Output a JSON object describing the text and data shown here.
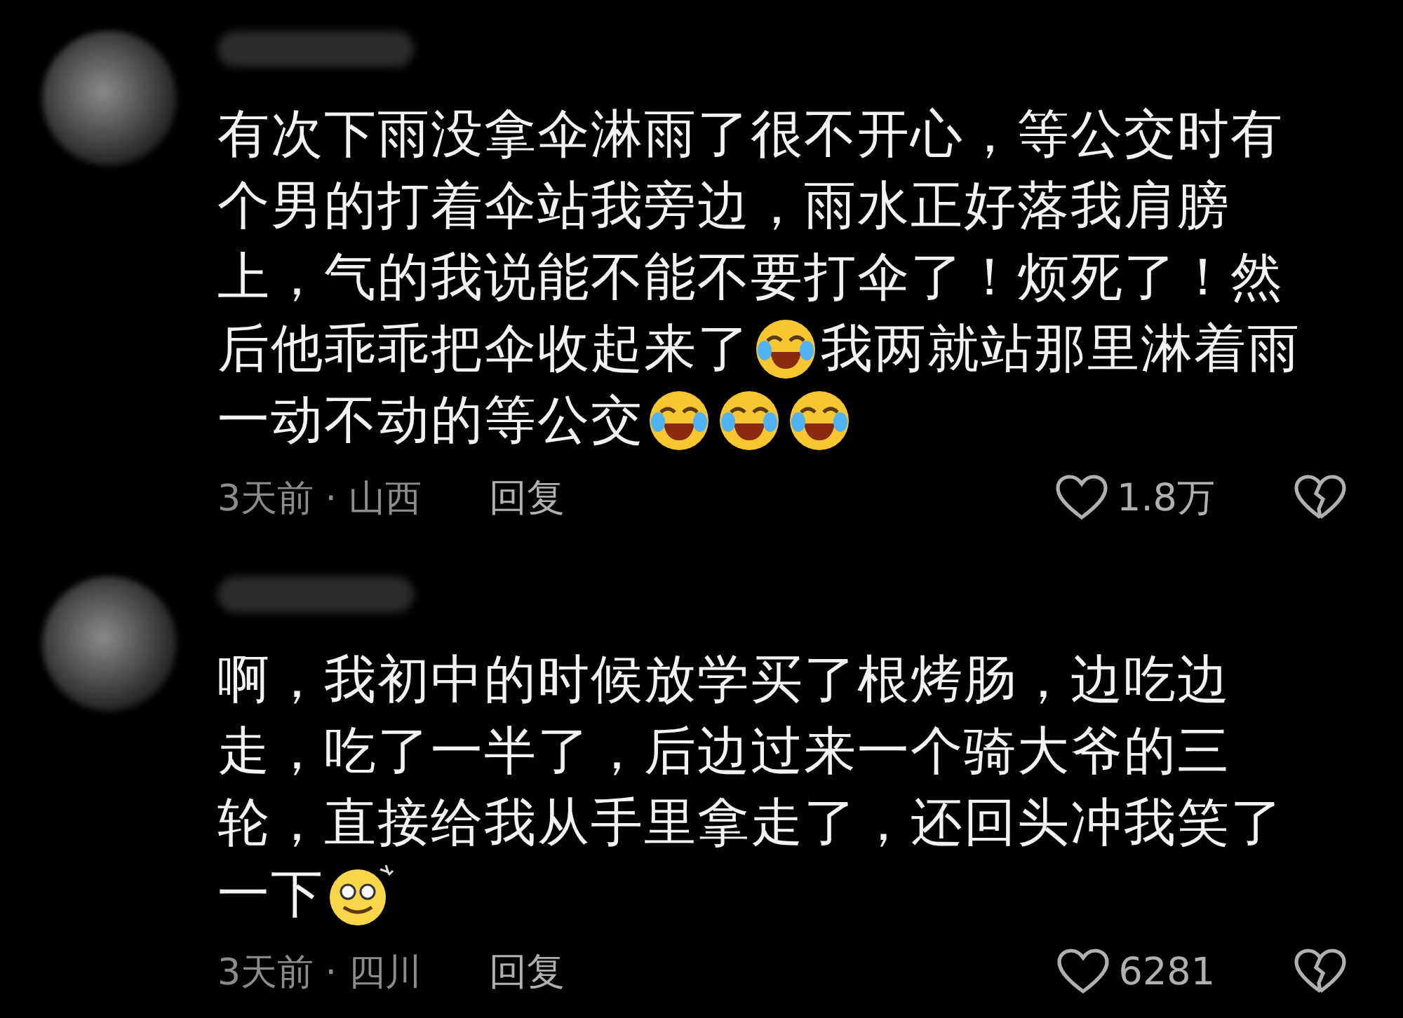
{
  "comments": [
    {
      "lines": [
        [
          {
            "kind": "text",
            "text": "有次下雨没拿伞淋雨了很不开心，等公交时有"
          }
        ],
        [
          {
            "kind": "text",
            "text": "个男的打着伞站我旁边，雨水正好落我肩膀"
          }
        ],
        [
          {
            "kind": "text",
            "text": "上，气的我说能不能不要打伞了！烦死了！然"
          }
        ],
        [
          {
            "kind": "text",
            "text": "后他乖乖把伞收起来了"
          },
          {
            "kind": "crying-laugh"
          },
          {
            "kind": "text",
            "text": "我两就站那里淋着雨"
          }
        ],
        [
          {
            "kind": "text",
            "text": "一动不动的等公交"
          },
          {
            "kind": "crying-laugh"
          },
          {
            "kind": "crying-laugh"
          },
          {
            "kind": "crying-laugh"
          }
        ]
      ],
      "meta": "3天前 · 山西",
      "reply": "回复",
      "likes": "1.8万"
    },
    {
      "lines": [
        [
          {
            "kind": "text",
            "text": "啊，我初中的时候放学买了根烤肠，边吃边"
          }
        ],
        [
          {
            "kind": "text",
            "text": "走，吃了一半了，后边过来一个骑大爷的三"
          }
        ],
        [
          {
            "kind": "text",
            "text": "轮，直接给我从手里拿走了，还回头冲我笑了"
          }
        ],
        [
          {
            "kind": "text",
            "text": "一下"
          },
          {
            "kind": "dizzy"
          }
        ]
      ],
      "meta": "3天前 · 四川",
      "reply": "回复",
      "likes": "6281"
    }
  ]
}
